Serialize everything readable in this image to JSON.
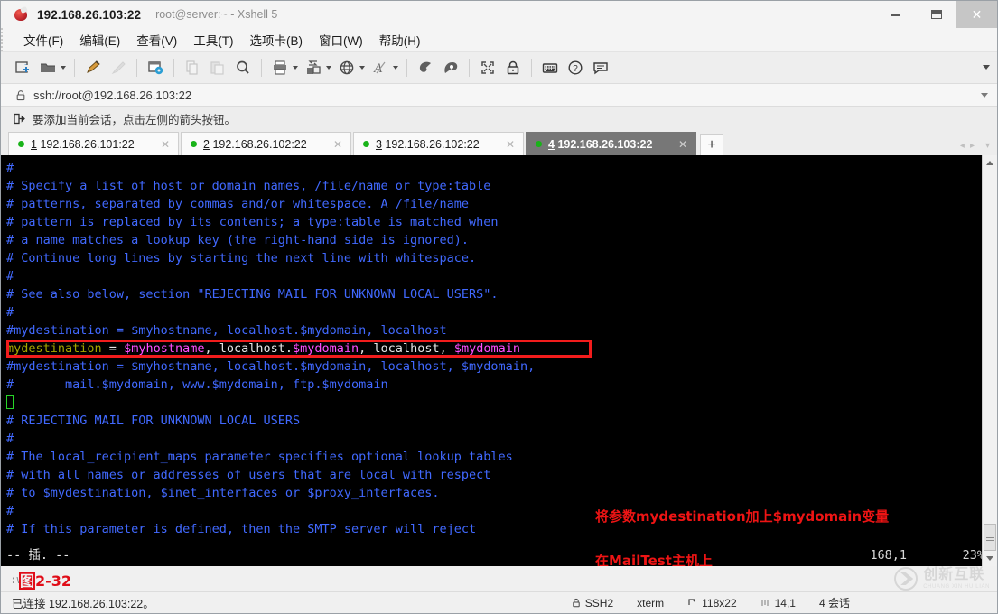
{
  "window": {
    "title": "192.168.26.103:22",
    "subtitle": "root@server:~ - Xshell 5",
    "app_icon": "xshell-icon",
    "controls": {
      "minimize": "minimize-icon",
      "maximize": "maximize-icon",
      "close": "✕"
    }
  },
  "menu": {
    "items": [
      {
        "label": "文件(F)",
        "name": "menu-file"
      },
      {
        "label": "编辑(E)",
        "name": "menu-edit"
      },
      {
        "label": "查看(V)",
        "name": "menu-view"
      },
      {
        "label": "工具(T)",
        "name": "menu-tools"
      },
      {
        "label": "选项卡(B)",
        "name": "menu-tabs"
      },
      {
        "label": "窗口(W)",
        "name": "menu-window"
      },
      {
        "label": "帮助(H)",
        "name": "menu-help"
      }
    ]
  },
  "toolbar": {
    "icons": [
      "new-session-icon",
      "open-folder-icon",
      "edit-pencil-icon",
      "disconnect-icon",
      "session-properties-icon",
      "copy-icon",
      "paste-icon",
      "find-icon",
      "print-icon",
      "transfer-icon",
      "browser-icon",
      "font-icon",
      "log-icon",
      "capture-icon",
      "fullscreen-icon",
      "lock-icon",
      "keyboard-icon",
      "help-icon",
      "chat-icon"
    ],
    "overflow": "toolbar-overflow-caret"
  },
  "address": {
    "lock_icon": "lock-icon",
    "value": "ssh://root@192.168.26.103:22",
    "placeholder": "ssh://",
    "dropdown": "address-dropdown-caret"
  },
  "hint": {
    "icon": "add-session-arrow-icon",
    "text": "要添加当前会话，点击左侧的箭头按钮。"
  },
  "tabs": {
    "items": [
      {
        "num": "1",
        "label": "192.168.26.101:22",
        "active": false
      },
      {
        "num": "2",
        "label": "192.168.26.102:22",
        "active": false
      },
      {
        "num": "3",
        "label": "192.168.26.102:22",
        "active": false
      },
      {
        "num": "4",
        "label": "192.168.26.103:22",
        "active": true
      }
    ],
    "add_label": "+",
    "close_glyph": "✕",
    "nav_prev": "◂",
    "nav_next": "▸",
    "nav_menu": "▾"
  },
  "terminal": {
    "lines": [
      [
        {
          "t": "#",
          "c": "comment"
        }
      ],
      [
        {
          "t": "# Specify a list of host or domain names, /file/name or type:table",
          "c": "comment"
        }
      ],
      [
        {
          "t": "# patterns, separated by commas and/or whitespace. A /file/name",
          "c": "comment"
        }
      ],
      [
        {
          "t": "# pattern is replaced by its contents; a type:table is matched when",
          "c": "comment"
        }
      ],
      [
        {
          "t": "# a name matches a lookup key (the right-hand side is ignored).",
          "c": "comment"
        }
      ],
      [
        {
          "t": "# Continue long lines by starting the next line with whitespace.",
          "c": "comment"
        }
      ],
      [
        {
          "t": "#",
          "c": "comment"
        }
      ],
      [
        {
          "t": "# See also below, section \"REJECTING MAIL FOR UNKNOWN LOCAL USERS\".",
          "c": "comment"
        }
      ],
      [
        {
          "t": "#",
          "c": "comment"
        }
      ],
      [
        {
          "t": "#mydestination = $myhostname, localhost.$mydomain, localhost",
          "c": "comment"
        }
      ],
      [
        {
          "t": "mydestination ",
          "c": "yellow"
        },
        {
          "t": "= ",
          "c": "white"
        },
        {
          "t": "$myhostname",
          "c": "magenta"
        },
        {
          "t": ", localhost.",
          "c": "white"
        },
        {
          "t": "$mydomain",
          "c": "magenta"
        },
        {
          "t": ", localhost, ",
          "c": "white"
        },
        {
          "t": "$mydomain",
          "c": "magenta"
        }
      ],
      [
        {
          "t": "#mydestination = $myhostname, localhost.$mydomain, localhost, $mydomain,",
          "c": "comment"
        }
      ],
      [
        {
          "t": "#       mail.$mydomain, www.$mydomain, ftp.$mydomain",
          "c": "comment"
        }
      ],
      [
        {
          "t": "█",
          "c": "cursor"
        }
      ],
      [
        {
          "t": "# REJECTING MAIL FOR UNKNOWN LOCAL USERS",
          "c": "comment"
        }
      ],
      [
        {
          "t": "#",
          "c": "comment"
        }
      ],
      [
        {
          "t": "# The local_recipient_maps parameter specifies optional lookup tables",
          "c": "comment"
        }
      ],
      [
        {
          "t": "# with all names or addresses of users that are local with respect",
          "c": "comment"
        }
      ],
      [
        {
          "t": "# to $mydestination, $inet_interfaces or $proxy_interfaces.",
          "c": "comment"
        }
      ],
      [
        {
          "t": "#",
          "c": "comment"
        }
      ],
      [
        {
          "t": "# If this parameter is defined, then the SMTP server will reject",
          "c": "comment"
        }
      ]
    ],
    "vim_status": "-- 插. --",
    "cursor_pos": "168,1",
    "percent": "23%",
    "highlight_index": 10
  },
  "annotations": [
    {
      "text": "将参数mydestination加上$mydomain变量",
      "name": "annotation-line-1"
    },
    {
      "text": "在MailTest主机上",
      "name": "annotation-line-2"
    }
  ],
  "caption": {
    "vw_text": ":w",
    "fig_prefix": "图",
    "fig_number": "2-32"
  },
  "watermark": {
    "cn": "创新互联",
    "en": "CHUANG XIN HU LIAN"
  },
  "statusbar": {
    "connected": "已连接 192.168.26.103:22。",
    "protocol": "SSH2",
    "termtype": "xterm",
    "size": "118x22",
    "cursor": "14,1",
    "sessions": "4 会话"
  },
  "colors": {
    "accent_red": "#f21c1c",
    "annotation_red": "#ee1414",
    "terminal_bg": "#000000",
    "comment_blue": "#4169ff",
    "magenta": "#ff4fff",
    "yellow": "#a5a500",
    "tab_active_bg": "#777777",
    "status_green": "#19b319"
  }
}
